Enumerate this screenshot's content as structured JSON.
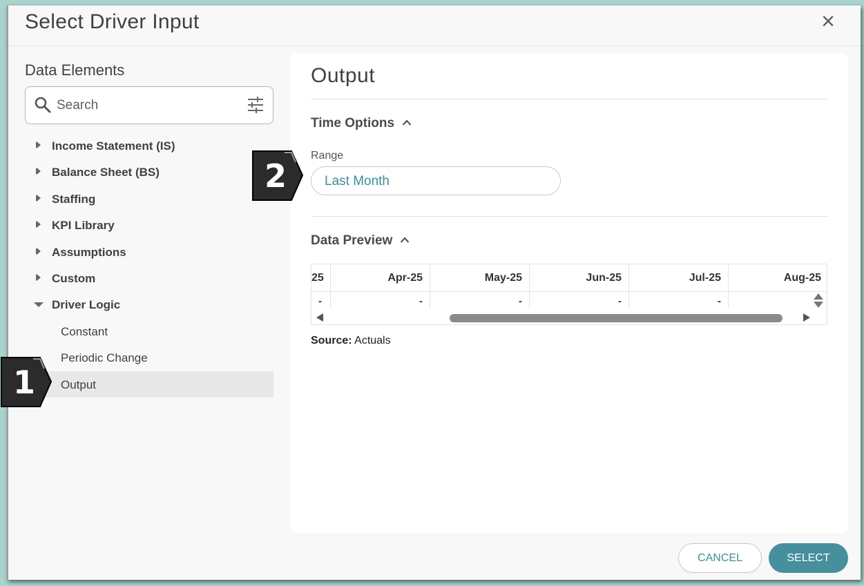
{
  "dialog": {
    "title": "Select Driver Input",
    "close_icon": "close-icon"
  },
  "left": {
    "title": "Data Elements",
    "search": {
      "placeholder": "Search",
      "value": ""
    },
    "tree": [
      {
        "label": "Income Statement (IS)",
        "expanded": false
      },
      {
        "label": "Balance Sheet (BS)",
        "expanded": false
      },
      {
        "label": "Staffing",
        "expanded": false
      },
      {
        "label": "KPI Library",
        "expanded": false
      },
      {
        "label": "Assumptions",
        "expanded": false
      },
      {
        "label": "Custom",
        "expanded": false
      },
      {
        "label": "Driver Logic",
        "expanded": true,
        "children": [
          {
            "label": "Constant",
            "selected": false
          },
          {
            "label": "Periodic Change",
            "selected": false
          },
          {
            "label": "Output",
            "selected": true
          }
        ]
      }
    ]
  },
  "callouts": {
    "one": "1",
    "two": "2"
  },
  "right": {
    "title": "Output",
    "time_options": {
      "heading": "Time Options",
      "range_label": "Range",
      "range_value": "Last Month"
    },
    "preview": {
      "heading": "Data Preview",
      "columns": [
        "25",
        "Apr-25",
        "May-25",
        "Jun-25",
        "Jul-25",
        "Aug-25"
      ],
      "values": [
        "-",
        "-",
        "-",
        "-",
        "-",
        ""
      ]
    },
    "source": {
      "label": "Source:",
      "value": "Actuals"
    }
  },
  "footer": {
    "cancel": "CANCEL",
    "select": "SELECT"
  },
  "colors": {
    "accent": "#468f9d",
    "accent_text": "#3f8c96",
    "background": "#a9d3cc"
  }
}
